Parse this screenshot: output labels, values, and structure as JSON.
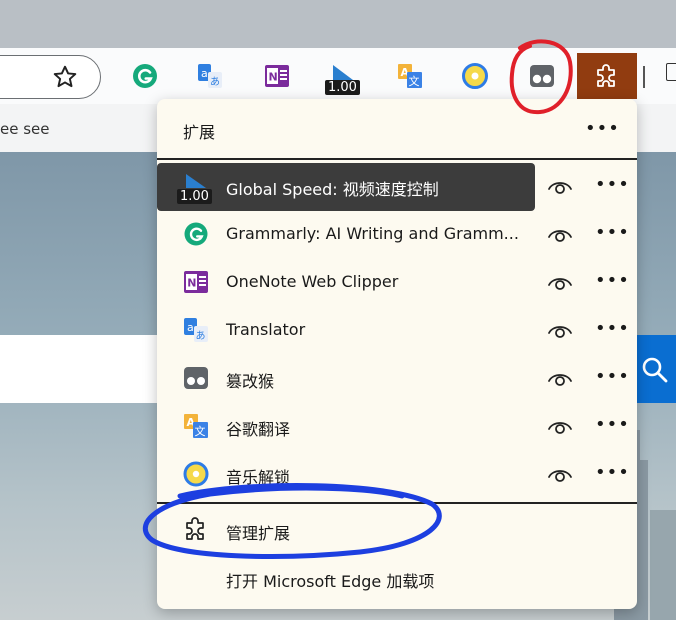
{
  "browser": {
    "favorites_text": "ee see",
    "toolbar_badge": "1.00"
  },
  "panel": {
    "title": "扩展",
    "more": "•••",
    "extensions": [
      {
        "label": "Global Speed: 视频速度控制",
        "badge": "1.00",
        "icon": "global-speed-icon"
      },
      {
        "label": "Grammarly: AI Writing and Gramm...",
        "icon": "grammarly-icon"
      },
      {
        "label": "OneNote Web Clipper",
        "icon": "onenote-icon"
      },
      {
        "label": "Translator",
        "icon": "translator-icon"
      },
      {
        "label": "篡改猴",
        "icon": "tampermonkey-icon"
      },
      {
        "label": "谷歌翻译",
        "icon": "google-translate-icon"
      },
      {
        "label": "音乐解锁",
        "icon": "music-unlock-icon"
      }
    ],
    "row_more": "•••",
    "manage_label": "管理扩展",
    "open_addons_label": "打开 Microsoft Edge 加载项"
  },
  "colors": {
    "panel_bg": "#fdfaf0",
    "active_row": "#3c3c3c",
    "extension_button": "#913c10",
    "annotation_red": "#e0202a",
    "annotation_blue": "#1d3fe0",
    "search_button": "#0a6ed1"
  }
}
